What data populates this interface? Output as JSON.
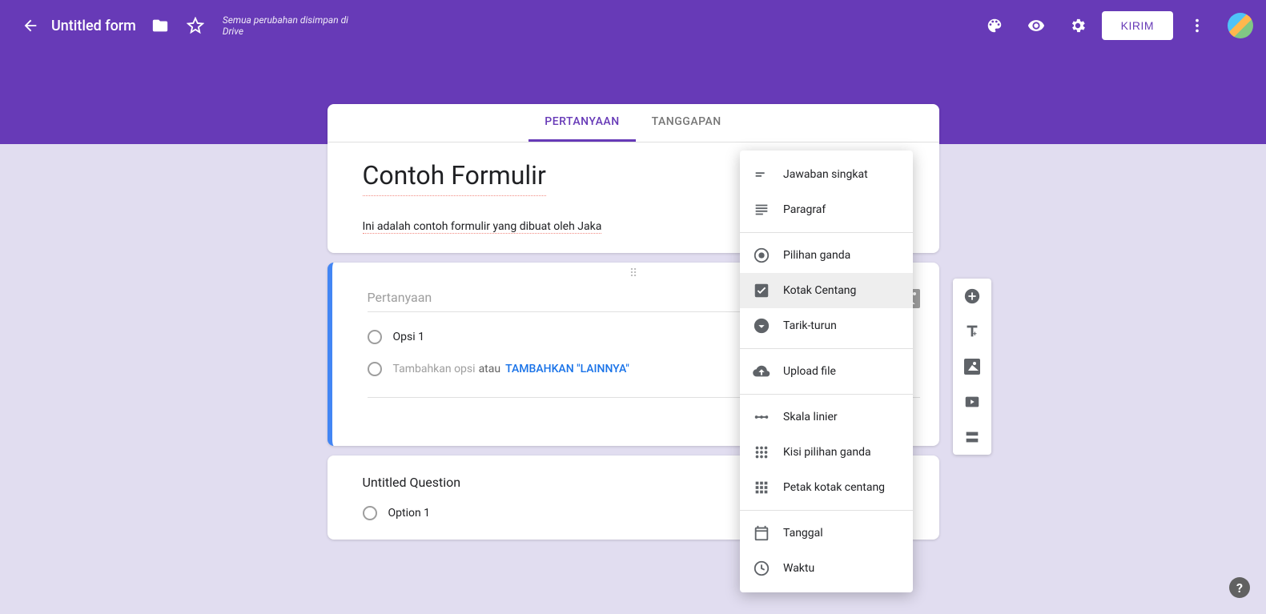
{
  "header": {
    "title": "Untitled form",
    "save_status": "Semua perubahan disimpan di Drive",
    "send_label": "KIRIM"
  },
  "tabs": {
    "questions": "PERTANYAAN",
    "responses": "TANGGAPAN"
  },
  "form": {
    "title": "Contoh Formulir",
    "description": "Ini adalah contoh formulir yang dibuat oleh Jaka"
  },
  "question1": {
    "placeholder": "Pertanyaan",
    "option1": "Opsi 1",
    "add_option": "Tambahkan opsi",
    "or": "atau",
    "add_other": "TAMBAHKAN \"LAINNYA\""
  },
  "question2": {
    "title": "Untitled Question",
    "option1": "Option 1"
  },
  "type_menu": {
    "short_answer": "Jawaban singkat",
    "paragraph": "Paragraf",
    "multiple_choice": "Pilihan ganda",
    "checkboxes": "Kotak Centang",
    "dropdown": "Tarik-turun",
    "file_upload": "Upload file",
    "linear_scale": "Skala linier",
    "grid_choice": "Kisi pilihan ganda",
    "grid_checkbox": "Petak kotak centang",
    "date": "Tanggal",
    "time": "Waktu"
  },
  "help": "?"
}
